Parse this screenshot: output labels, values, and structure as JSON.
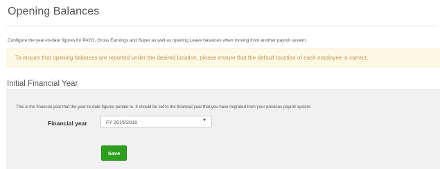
{
  "header": {
    "title": "Opening Balances",
    "description": "Configure the year-to-date figures for PAYG, Gross Earnings and Super as well as opening Leave balances when moving from another payroll system."
  },
  "alert": {
    "text": "To ensure that opening balances are reported under the desired location, please ensure that the default location of each employee is correct.",
    "color": "#c09853",
    "background": "#fcf8e3"
  },
  "financial_year_section": {
    "title": "Initial Financial Year",
    "description": "This is the financial year that the year-to-date figures pertain to. It should be set to the financial year that you have migrated from your previous payroll system.",
    "field_label": "Financial year",
    "select_value": "FY 2015/2016",
    "select_icon": "caret-down-icon",
    "save_label": "Save",
    "save_color": "#2ca01c"
  }
}
